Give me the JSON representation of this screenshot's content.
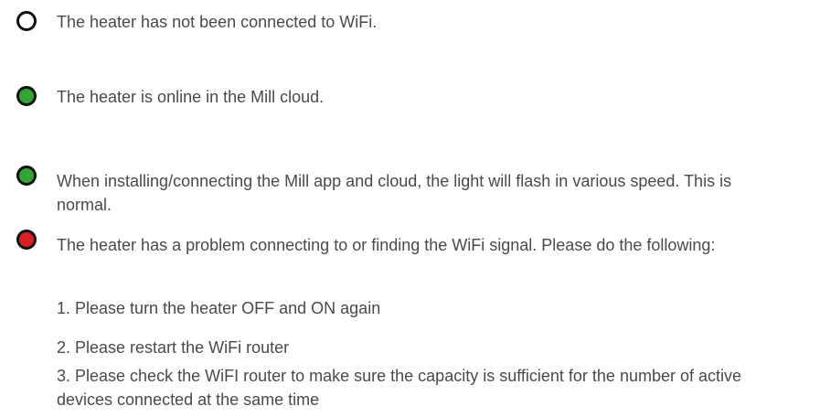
{
  "items": [
    {
      "status": "off",
      "color": "#ffffff",
      "text": "The heater has not been connected to WiFi."
    },
    {
      "status": "green",
      "color": "#34a534",
      "text": "The heater is online in the Mill cloud."
    },
    {
      "status": "green",
      "color": "#34a534",
      "text": "When installing/connecting the Mill app and cloud, the light will flash in various speed. This is normal."
    },
    {
      "status": "red",
      "color": "#d91f26",
      "text": "The heater has a problem connecting to or finding the WiFi signal. Please do the following:"
    }
  ],
  "steps": [
    "1. Please turn the heater OFF and ON again",
    "2. Please restart the WiFi router",
    "3. Please check the WiFI router to make sure the capacity is sufficient for the number of active devices connected at the same time"
  ]
}
